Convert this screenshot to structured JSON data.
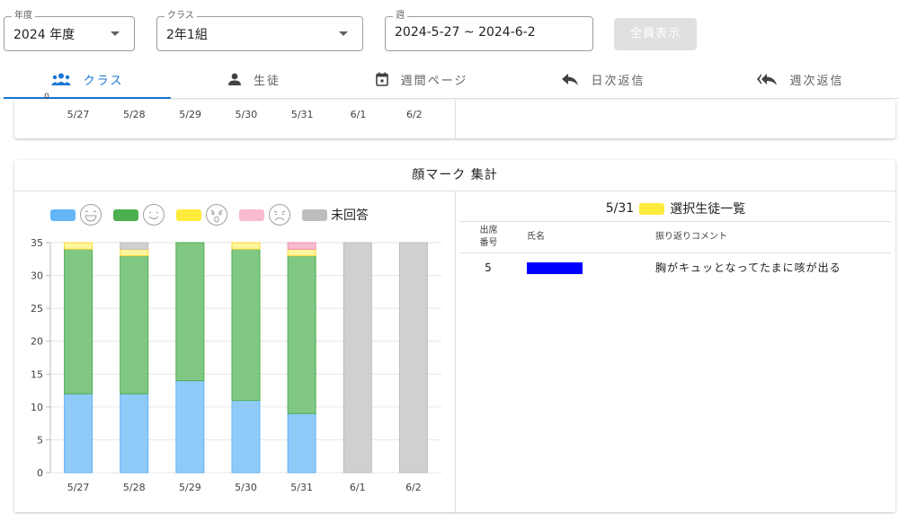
{
  "filters": {
    "year": {
      "label": "年度",
      "value": "2024 年度"
    },
    "class": {
      "label": "クラス",
      "value": "2年1組"
    },
    "week": {
      "label": "週",
      "value": "2024-5-27 ~ 2024-6-2"
    },
    "show_all_label": "全員表示"
  },
  "tabs": [
    {
      "label": "クラス",
      "icon": "group-icon",
      "active": true
    },
    {
      "label": "生徒",
      "icon": "person-icon",
      "active": false
    },
    {
      "label": "週間ページ",
      "icon": "calendar-icon",
      "active": false
    },
    {
      "label": "日次返信",
      "icon": "reply-icon",
      "active": false
    },
    {
      "label": "週次返信",
      "icon": "reply-all-icon",
      "active": false
    }
  ],
  "top_chart_fragment": {
    "y_tick": "0",
    "x_labels": [
      "5/27",
      "5/28",
      "5/29",
      "5/30",
      "5/31",
      "6/1",
      "6/2"
    ]
  },
  "face_card": {
    "title": "顔マーク 集計",
    "legend": [
      {
        "icon": "laughing-face-icon",
        "color": "#64b5f6"
      },
      {
        "icon": "smiling-face-icon",
        "color": "#4caf50"
      },
      {
        "icon": "surprised-face-icon",
        "color": "#ffeb3b"
      },
      {
        "icon": "crying-face-icon",
        "color": "#f8bbd0"
      },
      {
        "label": "未回答",
        "color": "#bdbdbd"
      }
    ],
    "selection": {
      "date": "5/31",
      "color": "#ffeb3b",
      "label": "選択生徒一覧"
    },
    "table": {
      "headers": {
        "number_line1": "出席",
        "number_line2": "番号",
        "name": "氏名",
        "comment": "振り返りコメント"
      },
      "rows": [
        {
          "number": "5",
          "name_redacted": true,
          "comment": "胸がキュッとなってたまに咳が出る"
        }
      ]
    }
  },
  "chart_data": {
    "type": "bar",
    "stacked": true,
    "categories": [
      "5/27",
      "5/28",
      "5/29",
      "5/30",
      "5/31",
      "6/1",
      "6/2"
    ],
    "series": [
      {
        "key": "blue",
        "color": "#90caf9",
        "stroke": "#64b5f6",
        "values": [
          12,
          12,
          14,
          11,
          9,
          0,
          0
        ]
      },
      {
        "key": "green",
        "color": "#81c784",
        "stroke": "#4caf50",
        "values": [
          22,
          21,
          21,
          23,
          24,
          0,
          0
        ]
      },
      {
        "key": "yellow",
        "color": "#fff59d",
        "stroke": "#fdd835",
        "values": [
          1,
          1,
          0,
          1,
          1,
          0,
          0
        ]
      },
      {
        "key": "pink",
        "color": "#f8bbd0",
        "stroke": "#f48fb1",
        "values": [
          0,
          0,
          0,
          0,
          1,
          0,
          0
        ]
      },
      {
        "name": "未回答",
        "key": "gray",
        "color": "#d0d0d0",
        "stroke": "#bdbdbd",
        "values": [
          0,
          1,
          0,
          0,
          0,
          35,
          35
        ]
      }
    ],
    "y_ticks": [
      0,
      5,
      10,
      15,
      20,
      25,
      30,
      35
    ],
    "ylim": [
      0,
      35
    ],
    "grid": true
  }
}
